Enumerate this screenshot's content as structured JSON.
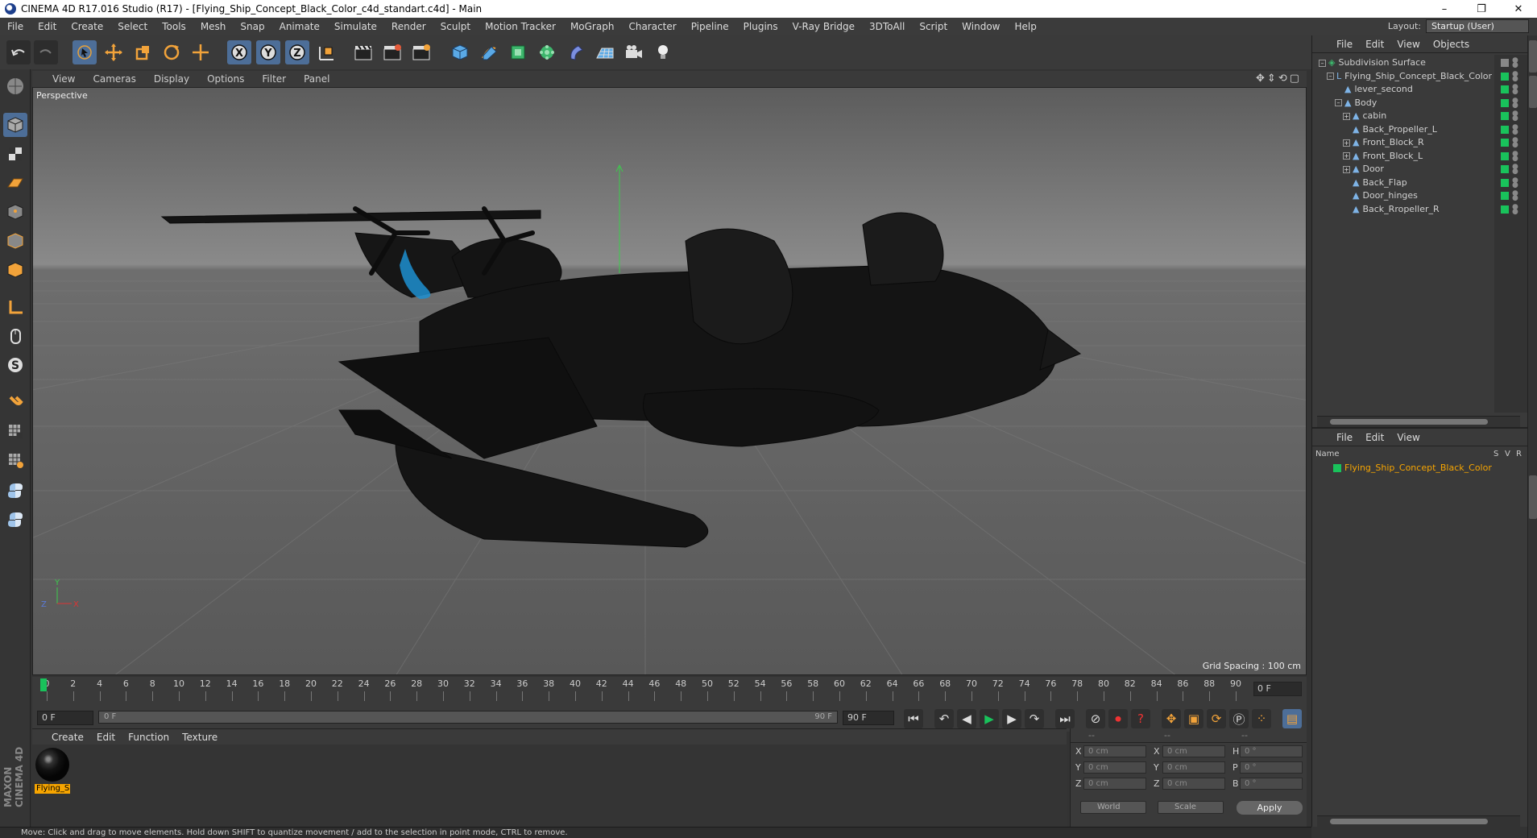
{
  "window": {
    "title": "CINEMA 4D R17.016 Studio (R17) - [Flying_Ship_Concept_Black_Color_c4d_standart.c4d] - Main",
    "controls": [
      "–",
      "❐",
      "✕"
    ]
  },
  "menubar": {
    "items": [
      "File",
      "Edit",
      "Create",
      "Select",
      "Tools",
      "Mesh",
      "Snap",
      "Animate",
      "Simulate",
      "Render",
      "Sculpt",
      "Motion Tracker",
      "MoGraph",
      "Character",
      "Pipeline",
      "Plugins",
      "V-Ray Bridge",
      "3DToAll",
      "Script",
      "Window",
      "Help"
    ],
    "layout_label": "Layout:",
    "layout_value": "Startup (User)"
  },
  "viewport": {
    "menu": [
      "View",
      "Cameras",
      "Display",
      "Options",
      "Filter",
      "Panel"
    ],
    "label": "Perspective",
    "grid_spacing": "Grid Spacing : 100 cm"
  },
  "timeline": {
    "ticks": [
      "0",
      "2",
      "4",
      "6",
      "8",
      "10",
      "12",
      "14",
      "16",
      "18",
      "20",
      "22",
      "24",
      "26",
      "28",
      "30",
      "32",
      "34",
      "36",
      "38",
      "40",
      "42",
      "44",
      "46",
      "48",
      "50",
      "52",
      "54",
      "56",
      "58",
      "60",
      "62",
      "64",
      "66",
      "68",
      "70",
      "72",
      "74",
      "76",
      "78",
      "80",
      "82",
      "84",
      "86",
      "88",
      "90"
    ],
    "current_frame": "0 F",
    "start_field": "0 F",
    "range_start": "0 F",
    "range_end": "90 F",
    "end_field": "90 F"
  },
  "material_manager": {
    "menu": [
      "Create",
      "Edit",
      "Function",
      "Texture"
    ],
    "materials": [
      {
        "label": "Flying_S"
      }
    ]
  },
  "coordinates": {
    "header": [
      "--",
      "--",
      "--"
    ],
    "rows": [
      {
        "pos_label": "X",
        "pos_value": "0 cm",
        "size_label": "X",
        "size_value": "0 cm",
        "rot_label": "H",
        "rot_value": "0 °"
      },
      {
        "pos_label": "Y",
        "pos_value": "0 cm",
        "size_label": "Y",
        "size_value": "0 cm",
        "rot_label": "P",
        "rot_value": "0 °"
      },
      {
        "pos_label": "Z",
        "pos_value": "0 cm",
        "size_label": "Z",
        "size_value": "0 cm",
        "rot_label": "B",
        "rot_value": "0 °"
      }
    ],
    "mode": "World",
    "size_mode": "Scale",
    "apply_label": "Apply"
  },
  "object_manager": {
    "menu": [
      "File",
      "Edit",
      "View",
      "Objects"
    ],
    "objects": [
      {
        "name": "Subdivision Surface",
        "depth": 0,
        "expand": "–",
        "icon": "subdivision-icon"
      },
      {
        "name": "Flying_Ship_Concept_Black_Color",
        "depth": 1,
        "expand": "–",
        "icon": "null-icon"
      },
      {
        "name": "lever_second",
        "depth": 2,
        "expand": "",
        "icon": "polygon-icon"
      },
      {
        "name": "Body",
        "depth": 2,
        "expand": "–",
        "icon": "polygon-icon"
      },
      {
        "name": "cabin",
        "depth": 3,
        "expand": "+",
        "icon": "polygon-icon"
      },
      {
        "name": "Back_Propeller_L",
        "depth": 3,
        "expand": "",
        "icon": "polygon-icon"
      },
      {
        "name": "Front_Block_R",
        "depth": 3,
        "expand": "+",
        "icon": "polygon-icon"
      },
      {
        "name": "Front_Block_L",
        "depth": 3,
        "expand": "+",
        "icon": "polygon-icon"
      },
      {
        "name": "Door",
        "depth": 3,
        "expand": "+",
        "icon": "polygon-icon"
      },
      {
        "name": "Back_Flap",
        "depth": 3,
        "expand": "",
        "icon": "polygon-icon"
      },
      {
        "name": "Door_hinges",
        "depth": 3,
        "expand": "",
        "icon": "polygon-icon"
      },
      {
        "name": "Back_Rropeller_R",
        "depth": 3,
        "expand": "",
        "icon": "polygon-icon"
      }
    ]
  },
  "layer_manager": {
    "menu": [
      "File",
      "Edit",
      "View"
    ],
    "columns": [
      "Name",
      "S",
      "V",
      "R"
    ],
    "selected": "Flying_Ship_Concept_Black_Color"
  },
  "statusbar": {
    "text": "Move: Click and drag to move elements. Hold down SHIFT to quantize movement / add to the selection in point mode, CTRL to remove."
  },
  "sidebar_brand": "MAXON CINEMA 4D",
  "colors": {
    "accent_blue": "#4d6e98",
    "active_green": "#19c25b",
    "selection_orange": "#f7a500"
  }
}
